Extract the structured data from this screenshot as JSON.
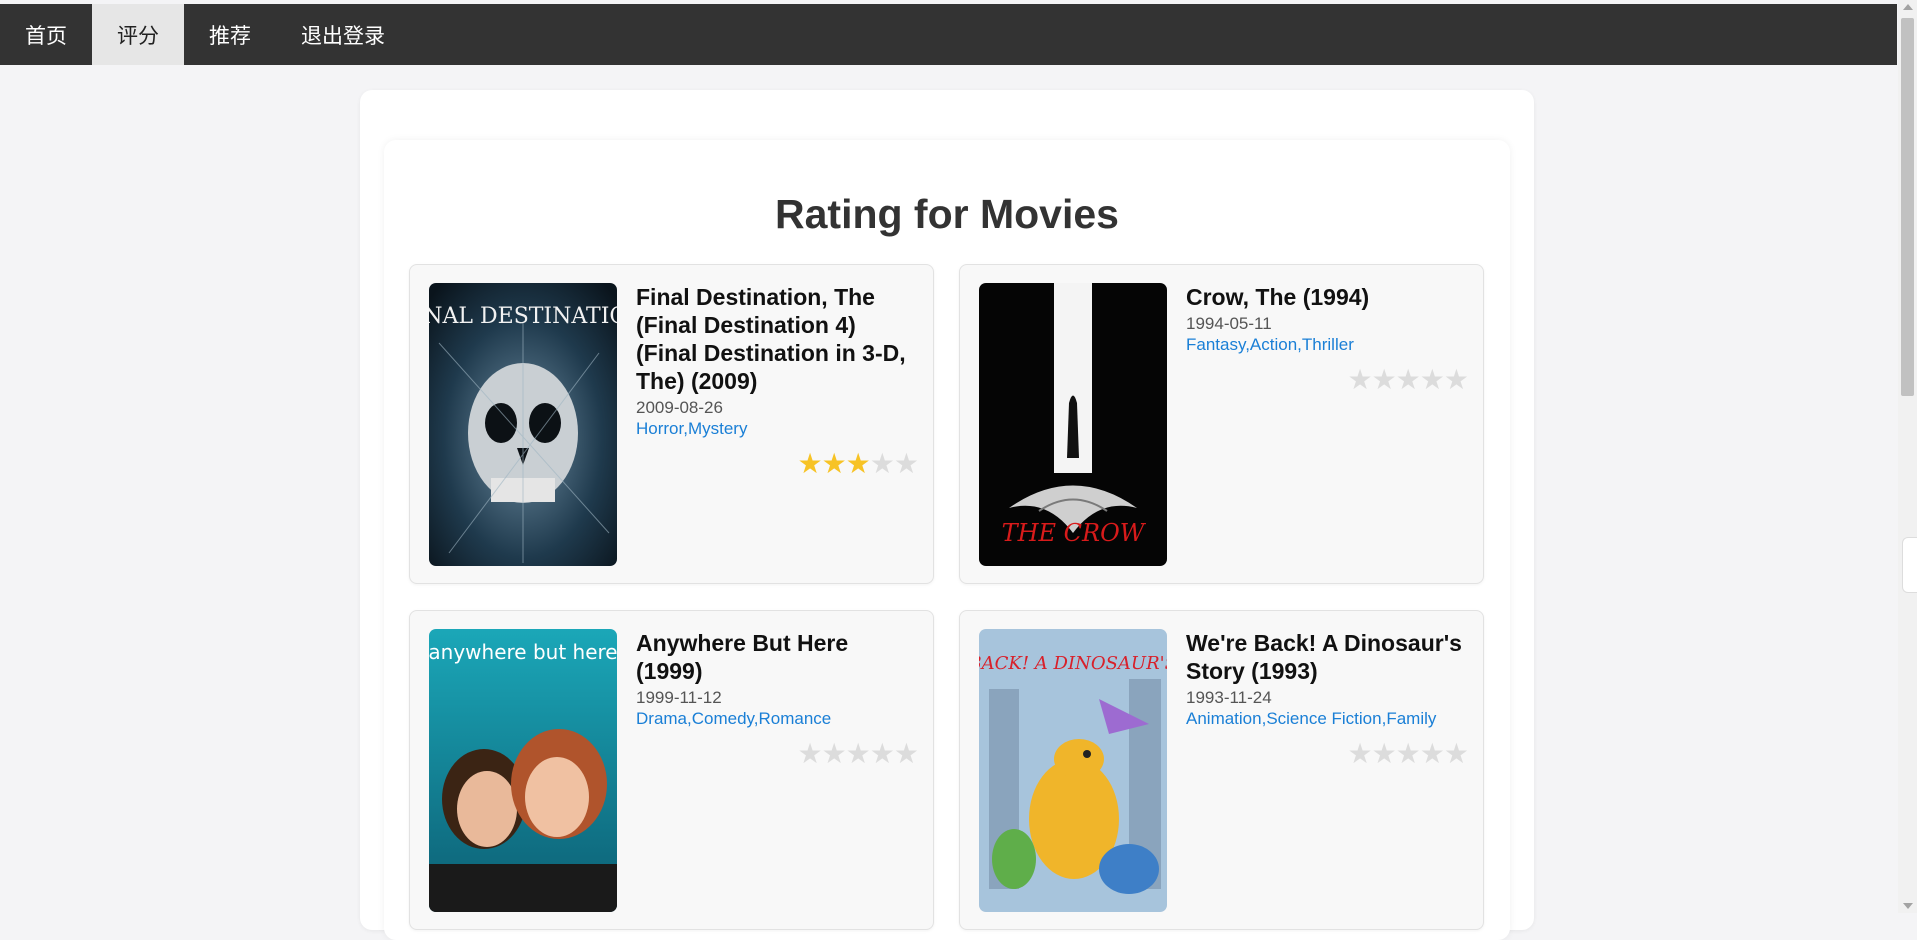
{
  "nav": {
    "items": [
      {
        "label": "首页",
        "active": false
      },
      {
        "label": "评分",
        "active": true
      },
      {
        "label": "推荐",
        "active": false
      },
      {
        "label": "退出登录",
        "active": false
      }
    ]
  },
  "page": {
    "title": "Rating for Movies"
  },
  "movies": [
    {
      "title": "Final Destination, The (Final Destination 4) (Final Destination in 3-D, The) (2009)",
      "date": "2009-08-26",
      "genres": "Horror,Mystery",
      "rating": 3,
      "max_rating": 5,
      "poster_text": "FINAL DESTINATION"
    },
    {
      "title": "Crow, The (1994)",
      "date": "1994-05-11",
      "genres": "Fantasy,Action,Thriller",
      "rating": 0,
      "max_rating": 5,
      "poster_text": "THE CROW"
    },
    {
      "title": "Anywhere But Here (1999)",
      "date": "1999-11-12",
      "genres": "Drama,Comedy,Romance",
      "rating": 0,
      "max_rating": 5,
      "poster_text": "anywhere but here"
    },
    {
      "title": "We're Back! A Dinosaur's Story (1993)",
      "date": "1993-11-24",
      "genres": "Animation,Science Fiction,Family",
      "rating": 0,
      "max_rating": 5,
      "poster_text": "WE'RE BACK! A DINOSAUR'S STORY"
    }
  ],
  "colors": {
    "nav_bg": "#333333",
    "nav_active_bg": "#e6e6e6",
    "star_on": "#f7c325",
    "star_off": "#dcdcdc",
    "genre_link": "#1a7fd6"
  }
}
